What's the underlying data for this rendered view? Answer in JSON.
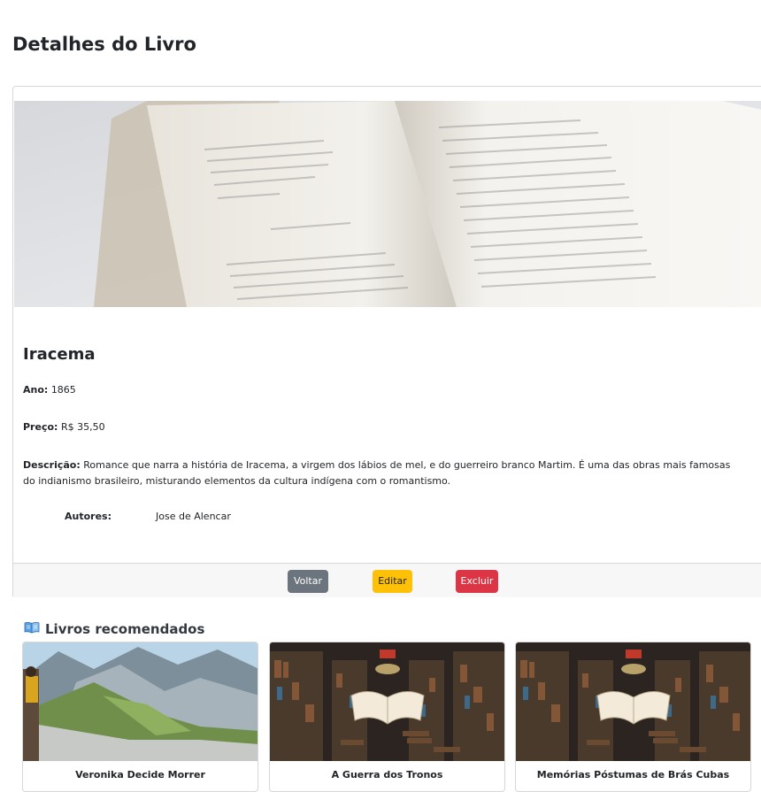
{
  "page": {
    "title": "Detalhes do Livro"
  },
  "book": {
    "title": "Iracema",
    "ano_label": "Ano:",
    "ano": "1865",
    "preco_label": "Preço:",
    "preco": "R$ 35,50",
    "descricao_label": "Descrição:",
    "descricao": "Romance que narra a história de Iracema, a virgem dos lábios de mel, e do guerreiro branco Martim. É uma das obras mais famosas do indianismo brasileiro, misturando elementos da cultura indígena com o romantismo.",
    "autores_label": "Autores:",
    "autores": "Jose de Alencar"
  },
  "actions": {
    "voltar": "Voltar",
    "editar": "Editar",
    "excluir": "Excluir"
  },
  "recommended": {
    "icon": "open-book-icon",
    "title": "Livros recomendados",
    "items": [
      {
        "title": "Veronika Decide Morrer"
      },
      {
        "title": "A Guerra dos Tronos"
      },
      {
        "title": "Memórias Póstumas de Brás Cubas"
      }
    ]
  },
  "colors": {
    "voltar": "#6c757d",
    "editar": "#ffc107",
    "excluir": "#dc3545"
  }
}
